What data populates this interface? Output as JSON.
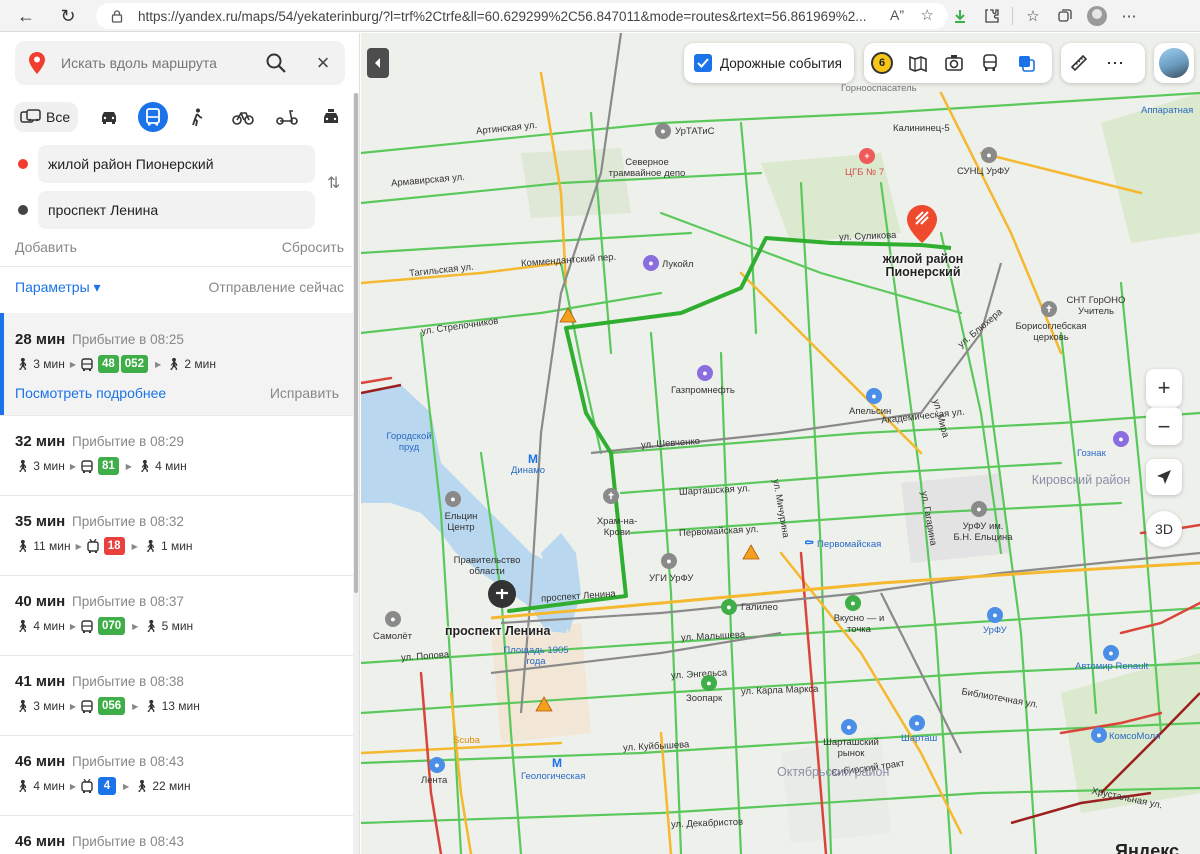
{
  "browser": {
    "url": "https://yandex.ru/maps/54/yekaterinburg/?l=trf%2Ctrfe&ll=60.629299%2C56.847011&mode=routes&rtext=56.861969%2..."
  },
  "search": {
    "placeholder": "Искать вдоль маршрута"
  },
  "modes": {
    "all_label": "Все",
    "items": [
      "car-icon",
      "bus-icon",
      "pedestrian-icon",
      "bicycle-icon",
      "scooter-icon",
      "taxi-icon"
    ],
    "active": "bus-icon"
  },
  "route_points": {
    "from": "жилой район Пионерский",
    "to": "проспект Ленина"
  },
  "actions": {
    "add": "Добавить",
    "reset": "Сбросить",
    "params": "Параметры ▾",
    "departure": "Отправление сейчас"
  },
  "routes": [
    {
      "duration": "28 мин",
      "arrival": "Прибытие в 08:25",
      "walk1": "3 мин",
      "vehicle": "bus",
      "badges": [
        {
          "text": "48",
          "color": "#3fae49"
        },
        {
          "text": "052",
          "color": "#3fae49"
        }
      ],
      "walk2": "2 мин",
      "more": "Посмотреть подробнее",
      "fix": "Исправить"
    },
    {
      "duration": "32 мин",
      "arrival": "Прибытие в 08:29",
      "walk1": "3 мин",
      "vehicle": "bus",
      "badges": [
        {
          "text": "81",
          "color": "#3fae49"
        }
      ],
      "walk2": "4 мин"
    },
    {
      "duration": "35 мин",
      "arrival": "Прибытие в 08:32",
      "walk1": "11 мин",
      "vehicle": "trolley",
      "badges": [
        {
          "text": "18",
          "color": "#e8403c"
        }
      ],
      "walk2": "1 мин"
    },
    {
      "duration": "40 мин",
      "arrival": "Прибытие в 08:37",
      "walk1": "4 мин",
      "vehicle": "bus",
      "badges": [
        {
          "text": "070",
          "color": "#3fae49"
        }
      ],
      "walk2": "5 мин"
    },
    {
      "duration": "41 мин",
      "arrival": "Прибытие в 08:38",
      "walk1": "3 мин",
      "vehicle": "bus",
      "badges": [
        {
          "text": "056",
          "color": "#3fae49"
        }
      ],
      "walk2": "13 мин"
    },
    {
      "duration": "46 мин",
      "arrival": "Прибытие в 08:43",
      "walk1": "4 мин",
      "vehicle": "trolley",
      "badges": [
        {
          "text": "4",
          "color": "#1a73e8"
        }
      ],
      "walk2": "22 мин"
    },
    {
      "duration": "46 мин",
      "arrival": "Прибытие в 08:43"
    }
  ],
  "map": {
    "traffic_chip": "Дорожные события",
    "traffic_score": "6",
    "zoom_in": "+",
    "zoom_out": "−",
    "mode_3d": "3D",
    "start_title": "проспект Ленина",
    "end_title_1": "жилой район",
    "end_title_2": "Пионерский",
    "logo": "Яндекс",
    "labels": [
      {
        "text": "Артинская ул.",
        "k": "street"
      },
      {
        "text": "Армавирская ул.",
        "k": "street"
      },
      {
        "text": "Тагильская ул.",
        "k": "street"
      },
      {
        "text": "ул. Стрелочников",
        "k": "street"
      },
      {
        "text": "Коммендантский пер.",
        "k": "street"
      },
      {
        "text": "ул. Суликова",
        "k": "street"
      },
      {
        "text": "ул. Шевченко",
        "k": "street"
      },
      {
        "text": "Шарташская ул.",
        "k": "street"
      },
      {
        "text": "Первомайская ул.",
        "k": "street"
      },
      {
        "text": "проспект Ленина",
        "k": "street"
      },
      {
        "text": "ул. Малышева",
        "k": "street"
      },
      {
        "text": "ул. Энгельса",
        "k": "street"
      },
      {
        "text": "ул. Карла Маркса",
        "k": "street"
      },
      {
        "text": "ул. Куйбышева",
        "k": "street"
      },
      {
        "text": "ул. Декабристов",
        "k": "street"
      },
      {
        "text": "ул. Блюхера",
        "k": "street"
      },
      {
        "text": "Академическая ул.",
        "k": "street"
      },
      {
        "text": "Сибирский тракт",
        "k": "street"
      },
      {
        "text": "Хрустальная ул.",
        "k": "street"
      },
      {
        "text": "ул. Попова",
        "k": "street"
      },
      {
        "text": "ул. Мичурина",
        "k": "street"
      },
      {
        "text": "ул. Мира",
        "k": "street"
      },
      {
        "text": "ул. Гагарина",
        "k": "street"
      },
      {
        "text": "Библиотечная ул.",
        "k": "street"
      },
      {
        "text": "УрТАТиС",
        "k": "poi"
      },
      {
        "text": "Северное трамвайное депо",
        "k": "poi"
      },
      {
        "text": "Лукойл",
        "k": "poi"
      },
      {
        "text": "Газпромнефть",
        "k": "poi"
      },
      {
        "text": "Апельсин",
        "k": "poi"
      },
      {
        "text": "Борисоглебская церковь",
        "k": "poi"
      },
      {
        "text": "СНТ ГорОНО Учитель",
        "k": "poi"
      },
      {
        "text": "Городской пруд",
        "k": "water"
      },
      {
        "text": "Динамо",
        "k": "metro"
      },
      {
        "text": "Храм-на-Крови",
        "k": "poi"
      },
      {
        "text": "Ельцин Центр",
        "k": "poi"
      },
      {
        "text": "Правительство области",
        "k": "poi"
      },
      {
        "text": "УГИ УрФУ",
        "k": "poi"
      },
      {
        "text": "Первомайская",
        "k": "metro"
      },
      {
        "text": "Галилео",
        "k": "poi"
      },
      {
        "text": "Вкусно — и точка",
        "k": "poi"
      },
      {
        "text": "УрФУ им. Б.Н. Ельцина",
        "k": "poi"
      },
      {
        "text": "Самолёт",
        "k": "poi"
      },
      {
        "text": "Площадь 1905 года",
        "k": "metro"
      },
      {
        "text": "Зоопарк",
        "k": "poi"
      },
      {
        "text": "Scuba",
        "k": "poi"
      },
      {
        "text": "Лента",
        "k": "poi"
      },
      {
        "text": "Геологическая",
        "k": "metro"
      },
      {
        "text": "Шарташский рынок",
        "k": "poi"
      },
      {
        "text": "Шарташ",
        "k": "poi"
      },
      {
        "text": "Октябрьский район",
        "k": "district"
      },
      {
        "text": "Кировский район",
        "k": "district"
      },
      {
        "text": "Автомир Renault",
        "k": "poi"
      },
      {
        "text": "КомсоМолл",
        "k": "poi"
      },
      {
        "text": "УрФУ",
        "k": "poi"
      },
      {
        "text": "Гознак",
        "k": "poi"
      },
      {
        "text": "Калининец-5",
        "k": "poi"
      },
      {
        "text": "СУНЦ УрФУ",
        "k": "poi"
      },
      {
        "text": "ЦГБ № 7",
        "k": "poi"
      },
      {
        "text": "Горнооспасатель",
        "k": "poi"
      },
      {
        "text": "Аппаратная",
        "k": "metro"
      }
    ]
  },
  "colors": {
    "accent": "#1a73e8",
    "route_line": "#2fae2f",
    "road_green": "#5bc85b",
    "road_yellow": "#f5b82e",
    "road_red": "#d9453a",
    "water": "#b9d7ef",
    "park": "#cfe6b8"
  }
}
